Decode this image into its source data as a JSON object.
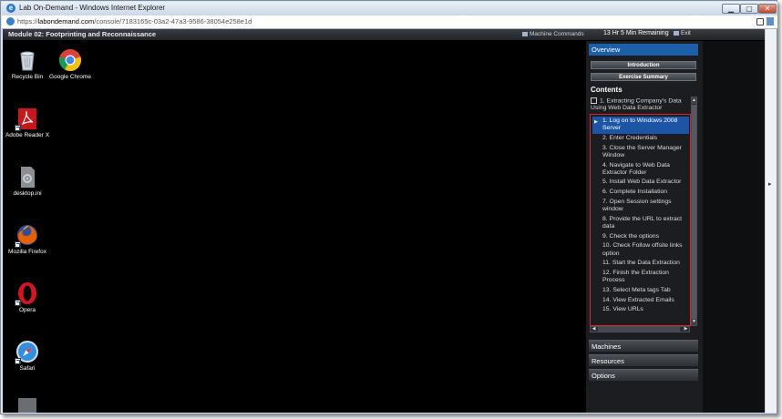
{
  "window": {
    "title": "Lab On-Demand - Windows Internet Explorer",
    "controls": {
      "minimize": "▁",
      "maximize": "▢",
      "close": "✕"
    }
  },
  "address": {
    "prefix": "https://",
    "domain": "labondemand.com",
    "path": "/console/7183165c-03a2-47a3-9586-38054e258e1d"
  },
  "toolbar": {
    "module_title": "Module 02: Footprinting and Reconnaissance",
    "machine_commands": "Machine Commands",
    "time_remaining": "13 Hr 5 Min Remaining",
    "exit": "Exit"
  },
  "desktop": {
    "icons": [
      {
        "label": "Recycle Bin",
        "icon": "recycle-bin-icon"
      },
      {
        "label": "Google Chrome",
        "icon": "chrome-icon"
      },
      {
        "label": "Adobe Reader X",
        "icon": "adobe-reader-icon"
      },
      {
        "label": "desktop.ini",
        "icon": "settings-file-icon"
      },
      {
        "label": "Mozilla Firefox",
        "icon": "firefox-icon"
      },
      {
        "label": "Opera",
        "icon": "opera-icon"
      },
      {
        "label": "Safari",
        "icon": "safari-icon"
      }
    ]
  },
  "panel": {
    "overview": "Overview",
    "introduction": "Introduction",
    "exercise_summary": "Exercise Summary",
    "contents_heading": "Contents",
    "section": "1. Extracting Company's Data Using Web Data Extractor",
    "steps": [
      "1. Log on to Windows 2008 Server",
      "2. Enter Credentials",
      "3. Close the Server Manager Window",
      "4. Navigate to Web Data Extractor Folder",
      "5. Install Web Data Extractor",
      "6. Complete Installation",
      "7. Open Session settings window",
      "8. Provide the URL to extract data",
      "9. Check the options",
      "10. Check Follow offsite links option",
      "11. Start  the Data Extraction",
      "12. Finish the Extraction Process",
      "13. Select Meta tags Tab",
      "14. View Extracted Emails",
      "15. View URLs"
    ],
    "active_step": 0,
    "machines": "Machines",
    "resources": "Resources",
    "options": "Options"
  },
  "colors": {
    "accent_blue": "#1a5fa8",
    "highlight_red": "#d9232f",
    "panel_bg": "#1b1d21"
  }
}
